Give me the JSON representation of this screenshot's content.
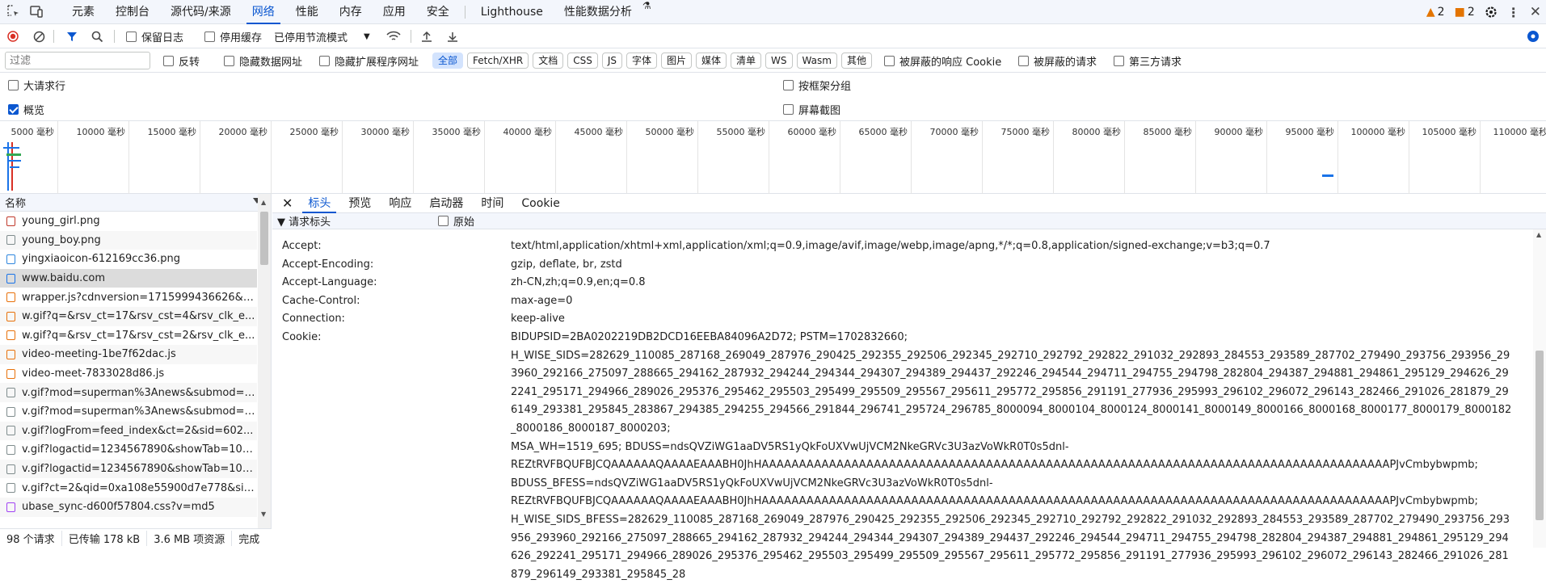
{
  "tabs": [
    "元素",
    "控制台",
    "源代码/来源",
    "网络",
    "性能",
    "内存",
    "应用",
    "安全",
    "Lighthouse",
    "性能数据分析"
  ],
  "active_tab": "网络",
  "warnings_count": "2",
  "errors_count": "2",
  "toolbar": {
    "preserve_log": "保留日志",
    "disable_cache": "停用缓存",
    "throttling": "已停用节流模式"
  },
  "filter": {
    "placeholder": "过滤",
    "invert": "反转",
    "hide_data_urls": "隐藏数据网址",
    "hide_ext_urls": "隐藏扩展程序网址",
    "types": [
      "全部",
      "Fetch/XHR",
      "文档",
      "CSS",
      "JS",
      "字体",
      "图片",
      "媒体",
      "清单",
      "WS",
      "Wasm",
      "其他"
    ],
    "blocked_cookies": "被屏蔽的响应 Cookie",
    "blocked_requests": "被屏蔽的请求",
    "third_party": "第三方请求"
  },
  "options": {
    "big_rows": "大请求行",
    "overview": "概览",
    "group_by_frame": "按框架分组",
    "screenshots": "屏幕截图"
  },
  "timeline_ticks": [
    "5000 毫秒",
    "10000 毫秒",
    "15000 毫秒",
    "20000 毫秒",
    "25000 毫秒",
    "30000 毫秒",
    "35000 毫秒",
    "40000 毫秒",
    "45000 毫秒",
    "50000 毫秒",
    "55000 毫秒",
    "60000 毫秒",
    "65000 毫秒",
    "70000 毫秒",
    "75000 毫秒",
    "80000 毫秒",
    "85000 毫秒",
    "90000 毫秒",
    "95000 毫秒",
    "100000 毫秒",
    "105000 毫秒",
    "110000 毫秒"
  ],
  "list": {
    "header": "名称",
    "requests": [
      {
        "name": "young_girl.png",
        "color": "#c0392b"
      },
      {
        "name": "young_boy.png",
        "color": "#7f8c8d"
      },
      {
        "name": "yingxiaoicon-612169cc36.png",
        "color": "#2e86de"
      },
      {
        "name": "www.baidu.com",
        "color": "#1a73e8"
      },
      {
        "name": "wrapper.js?cdnversion=1715999436626&_...",
        "color": "#e8710a"
      },
      {
        "name": "w.gif?q=&rsv_ct=17&rsv_cst=4&rsv_clk_e...",
        "color": "#e8710a"
      },
      {
        "name": "w.gif?q=&rsv_ct=17&rsv_cst=2&rsv_clk_e...",
        "color": "#e8710a"
      },
      {
        "name": "video-meeting-1be7f62dac.js",
        "color": "#e8710a"
      },
      {
        "name": "video-meet-7833028d86.js",
        "color": "#e8710a"
      },
      {
        "name": "v.gif?mod=superman%3Anews&submod=i...",
        "color": "#7f8c8d"
      },
      {
        "name": "v.gif?mod=superman%3Anews&submod=i...",
        "color": "#7f8c8d"
      },
      {
        "name": "v.gif?logFrom=feed_index&ct=2&sid=602...",
        "color": "#7f8c8d"
      },
      {
        "name": "v.gif?logactid=1234567890&showTab=100...",
        "color": "#7f8c8d"
      },
      {
        "name": "v.gif?logactid=1234567890&showTab=100...",
        "color": "#7f8c8d"
      },
      {
        "name": "v.gif?ct=2&qid=0xa108e55900d7e778&sid...",
        "color": "#7f8c8d"
      },
      {
        "name": "ubase_sync-d600f57804.css?v=md5",
        "color": "#a142f4"
      }
    ]
  },
  "status": {
    "requests": "98 个请求",
    "transferred": "已传输 178 kB",
    "resources": "3.6 MB 项资源",
    "finish": "完成"
  },
  "detail": {
    "tabs": [
      "标头",
      "预览",
      "响应",
      "启动器",
      "时间",
      "Cookie"
    ],
    "active": "标头",
    "section": "▼ 请求标头",
    "raw": "原始",
    "headers": [
      {
        "k": "Accept:",
        "v": "text/html,application/xhtml+xml,application/xml;q=0.9,image/avif,image/webp,image/apng,*/*;q=0.8,application/signed-exchange;v=b3;q=0.7"
      },
      {
        "k": "Accept-Encoding:",
        "v": "gzip, deflate, br, zstd"
      },
      {
        "k": "Accept-Language:",
        "v": "zh-CN,zh;q=0.9,en;q=0.8"
      },
      {
        "k": "Cache-Control:",
        "v": "max-age=0"
      },
      {
        "k": "Connection:",
        "v": "keep-alive"
      },
      {
        "k": "Cookie:",
        "v": "BIDUPSID=2BA0202219DB2DCD16EEBA84096A2D72; PSTM=1702832660;\nH_WISE_SIDS=282629_110085_287168_269049_287976_290425_292355_292506_292345_292710_292792_292822_291032_292893_284553_293589_287702_279490_293756_293956_293960_292166_275097_288665_294162_287932_294244_294344_294307_294389_294437_292246_294544_294711_294755_294798_282804_294387_294881_294861_295129_294626_292241_295171_294966_289026_295376_295462_295503_295499_295509_295567_295611_295772_295856_291191_277936_295993_296102_296072_296143_282466_291026_281879_296149_293381_295845_283867_294385_294255_294566_291844_296741_295724_296785_8000094_8000104_8000124_8000141_8000149_8000166_8000168_8000177_8000179_8000182_8000186_8000187_8000203;\nMSA_WH=1519_695; BDUSS=ndsQVZiWG1aaDV5RS1yQkFoUXVwUjVCM2NkeGRVc3U3azVoWkR0T0s5dnl-\nREZtRVFBQUFBJCQAAAAAAQAAAAEAAABH0JhHAAAAAAAAAAAAAAAAAAAAAAAAAAAAAAAAAAAAAAAAAAAAAAAAAAAAAAAAAAAAAAAAAAAAAAAAAAAAAAAAAAAAPJvCmbybwpmb;\nBDUSS_BFESS=ndsQVZiWG1aaDV5RS1yQkFoUXVwUjVCM2NkeGRVc3U3azVoWkR0T0s5dnl-\nREZtRVFBQUFBJCQAAAAAAQAAAAEAAABH0JhHAAAAAAAAAAAAAAAAAAAAAAAAAAAAAAAAAAAAAAAAAAAAAAAAAAAAAAAAAAAAAAAAAAAAAAAAAAAAAAAAAAAAPJvCmbybwpmb;\nH_WISE_SIDS_BFESS=282629_110085_287168_269049_287976_290425_292355_292506_292345_292710_292792_292822_291032_292893_284553_293589_287702_279490_293756_293956_293960_292166_275097_288665_294162_287932_294244_294344_294307_294389_294437_292246_294544_294711_294755_294798_282804_294387_294881_294861_295129_294626_292241_295171_294966_289026_295376_295462_295503_295499_295509_295567_295611_295772_295856_291191_277936_295993_296102_296072_296143_282466_291026_281879_296149_293381_295845_28"
      }
    ]
  }
}
